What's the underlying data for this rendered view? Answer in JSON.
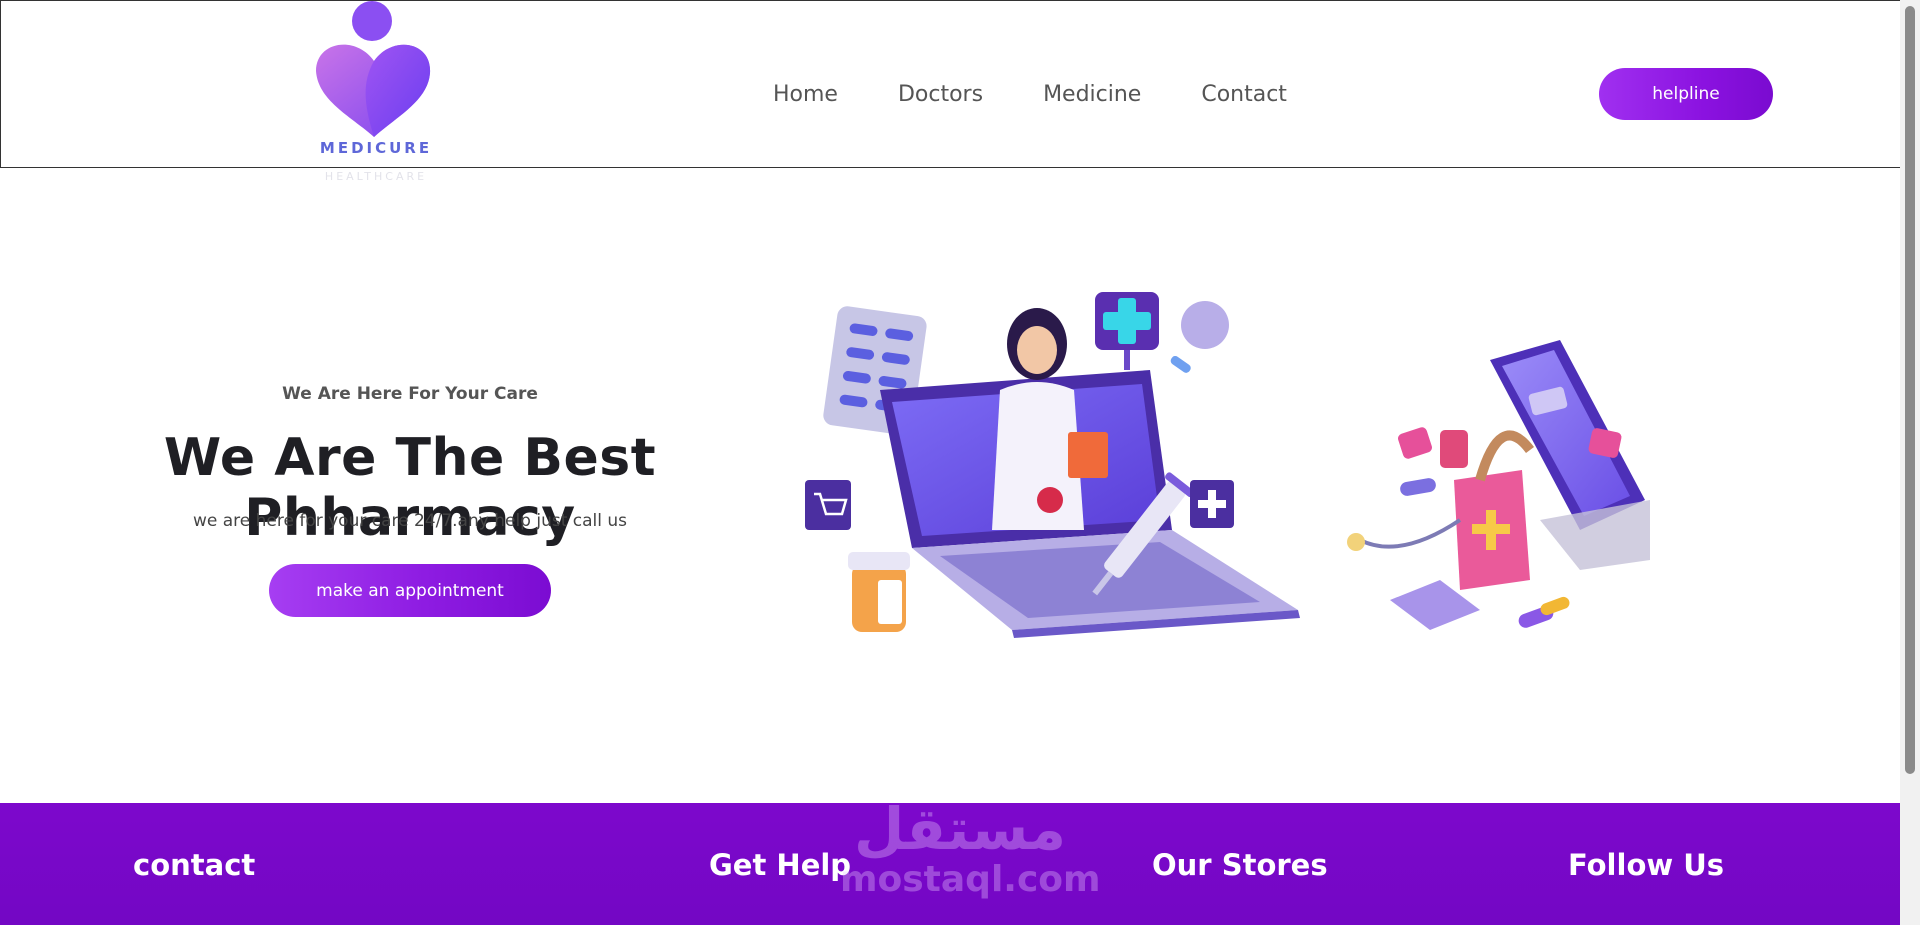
{
  "brand": {
    "name": "MEDICURE",
    "subtitle": "HEALTHCARE"
  },
  "nav": {
    "items": [
      {
        "label": "Home"
      },
      {
        "label": "Doctors"
      },
      {
        "label": "Medicine"
      },
      {
        "label": "Contact"
      }
    ],
    "helpline_label": "helpline"
  },
  "hero": {
    "eyebrow": "We Are Here For Your Care",
    "title": "We Are The Best Phharmacy",
    "text": "we are here for your care 24/7.any help just call us",
    "cta_label": "make an appointment"
  },
  "footer": {
    "columns": [
      {
        "title": "contact"
      },
      {
        "title": "Get Help"
      },
      {
        "title": "Our Stores"
      },
      {
        "title": "Follow Us"
      }
    ]
  },
  "watermark": {
    "arabic": "مستقل",
    "latin": "mostaql.com"
  },
  "colors": {
    "accent": "#8b12e0",
    "footer": "#7a08ca",
    "logo_text": "#5e67d8",
    "heading": "#1f1f24"
  },
  "icons": [
    "heart-person-logo-icon"
  ]
}
